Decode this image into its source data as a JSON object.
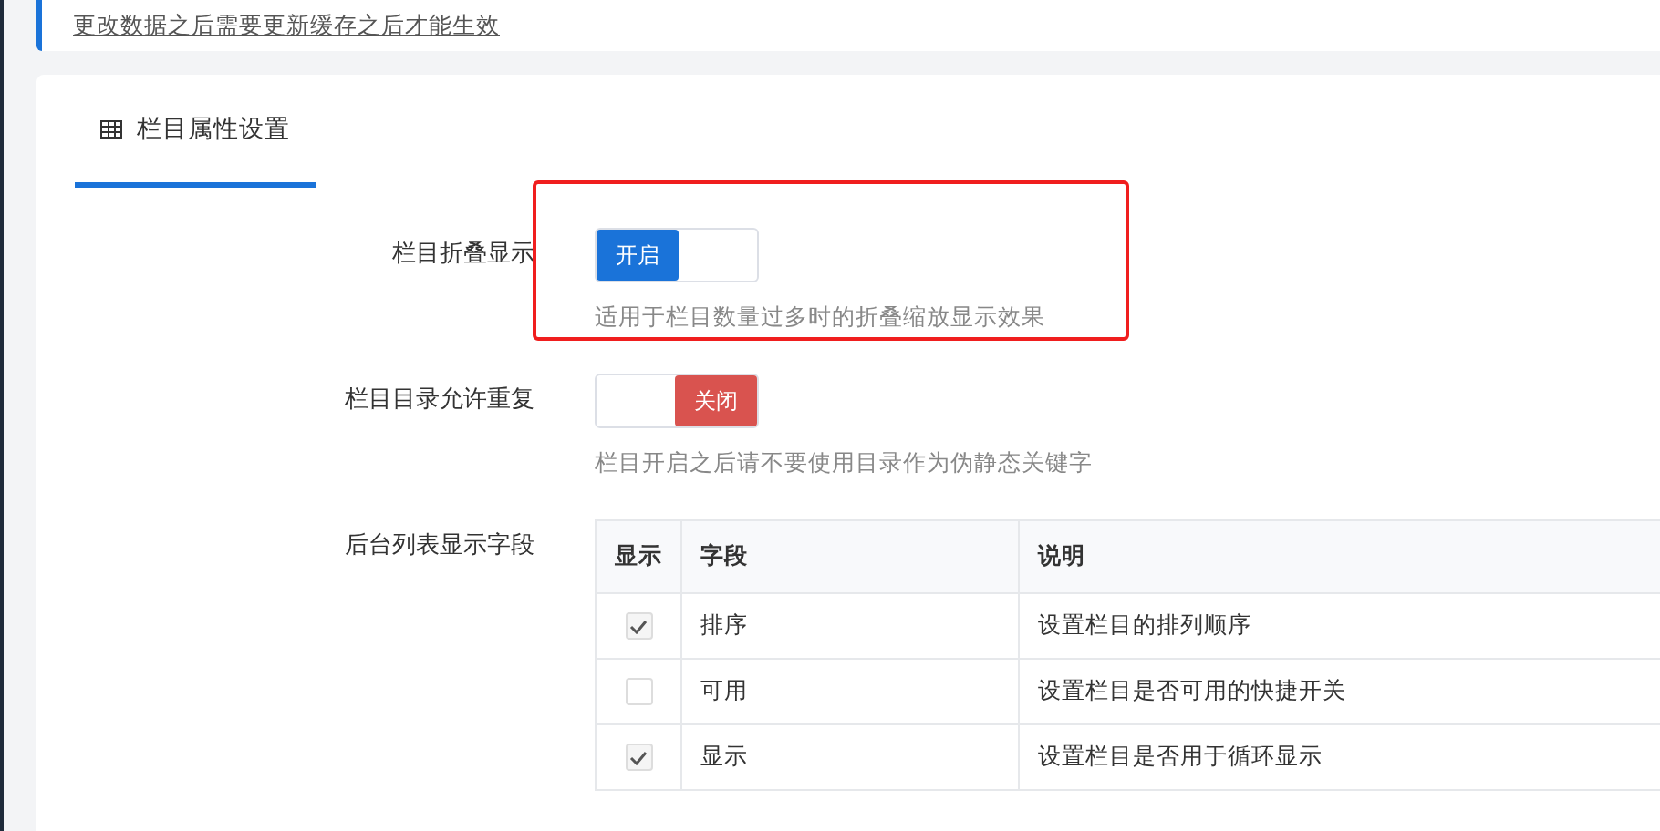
{
  "notice": {
    "text": "更改数据之后需要更新缓存之后才能生效"
  },
  "tabs": [
    {
      "label": "栏目属性设置",
      "selected": true
    }
  ],
  "highlight": {
    "shown": true
  },
  "settings": [
    {
      "label": "栏目折叠显示",
      "switch_text": "开启",
      "on": true,
      "help": "适用于栏目数量过多时的折叠缩放显示效果"
    },
    {
      "label": "栏目目录允许重复",
      "switch_text": "关闭",
      "on": false,
      "help": "栏目开启之后请不要使用目录作为伪静态关键字"
    }
  ],
  "fields": {
    "label": "后台列表显示字段",
    "columns": [
      "显示",
      "字段",
      "说明"
    ],
    "rows": [
      {
        "checked": true,
        "field": "排序",
        "description": "设置栏目的排列顺序"
      },
      {
        "checked": false,
        "field": "可用",
        "description": "设置栏目是否可用的快捷开关"
      },
      {
        "checked": true,
        "field": "显示",
        "description": "设置栏目是否用于循环显示"
      }
    ]
  }
}
